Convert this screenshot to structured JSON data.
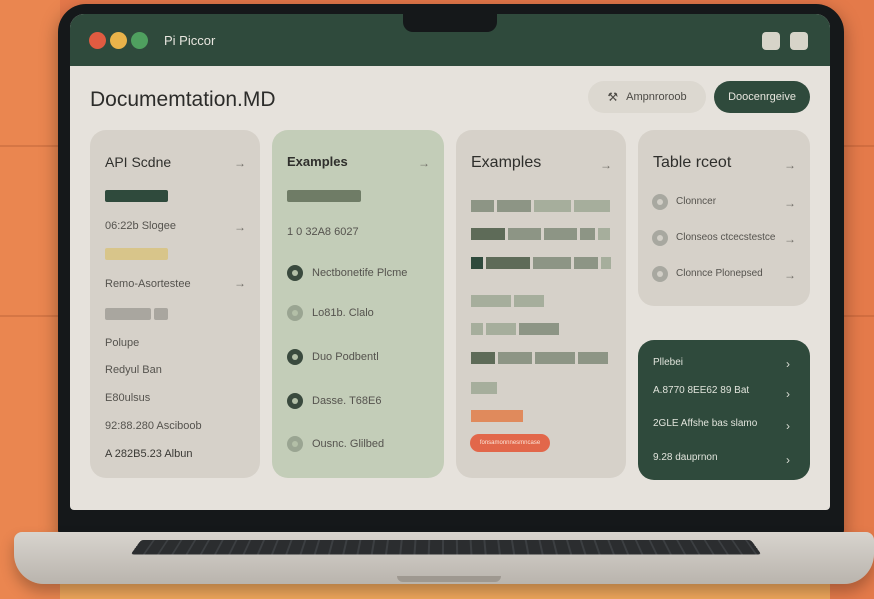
{
  "app": {
    "title": "Pi Piccor"
  },
  "header": {
    "page_title": "Documemtation.MD",
    "secondary_button": "Ampnroroob",
    "primary_button": "Doocenrgeive"
  },
  "cards": {
    "api": {
      "title": "API Scdne",
      "items": [
        "06:22b Slogee",
        "Remo-Asortestee",
        "Polupe",
        "Redyul Ban",
        "E80ulsus",
        "92:88.280 Asciboob",
        "A 282B5.23 Albun"
      ]
    },
    "examples1": {
      "title": "Examples",
      "code": "1 0 32A8 6027",
      "items": [
        "Nectbonetife Plcme",
        "Lo81b. Clalo",
        "Duo Podbentl",
        "Dasse. T68E6",
        "Ousnc. Glilbed"
      ]
    },
    "examples2": {
      "title": "Examples",
      "pill_label": "fonsamonnnesmncase"
    },
    "table": {
      "title": "Table rceot",
      "items": [
        "Clonncer",
        "Clonseos ctcecstestce",
        "Clonnce Plonepsed"
      ]
    },
    "dark": {
      "items": [
        "Pllebei",
        "A.8770 8EE62 89 Bat",
        "2GLE Affshe bas slamo",
        "9.28 dauprnon"
      ]
    }
  },
  "colors": {
    "brand_dark_green": "#2f4a3c",
    "accent_orange": "#e2674a",
    "sand": "#d8c58a"
  },
  "icons": {
    "chevron": "chevron-right-icon",
    "secondary_button_icon": "tool-icon"
  }
}
